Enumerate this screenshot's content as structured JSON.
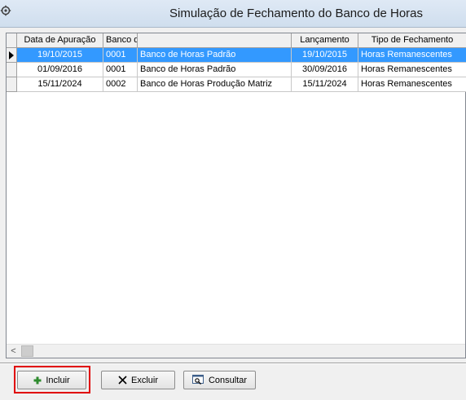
{
  "window": {
    "title": "Simulação de Fechamento do Banco de Horas"
  },
  "grid": {
    "columns": [
      "Data de Apuração",
      "Banco de Horas",
      "",
      "Lançamento",
      "Tipo de Fechamento"
    ],
    "rows": [
      {
        "data_apuracao": "19/10/2015",
        "codigo": "0001",
        "banco": "Banco de Horas Padrão",
        "lancamento": "19/10/2015",
        "tipo": "Horas Remanescentes",
        "selected": true
      },
      {
        "data_apuracao": "01/09/2016",
        "codigo": "0001",
        "banco": "Banco de Horas Padrão",
        "lancamento": "30/09/2016",
        "tipo": "Horas Remanescentes",
        "selected": false
      },
      {
        "data_apuracao": "15/11/2024",
        "codigo": "0002",
        "banco": "Banco de Horas Produção Matriz",
        "lancamento": "15/11/2024",
        "tipo": "Horas Remanescentes",
        "selected": false
      }
    ],
    "scroll_left_glyph": "<"
  },
  "toolbar": {
    "incluir_label": "Incluir",
    "excluir_label": "Excluir",
    "consultar_label": "Consultar"
  },
  "colors": {
    "selection": "#3399ff",
    "highlight_box": "#e00000",
    "add_icon": "#2e8b2e"
  },
  "icons": {
    "incluir": "plus-icon",
    "excluir": "x-icon",
    "consultar": "search-document-icon",
    "app": "gear-icon"
  }
}
